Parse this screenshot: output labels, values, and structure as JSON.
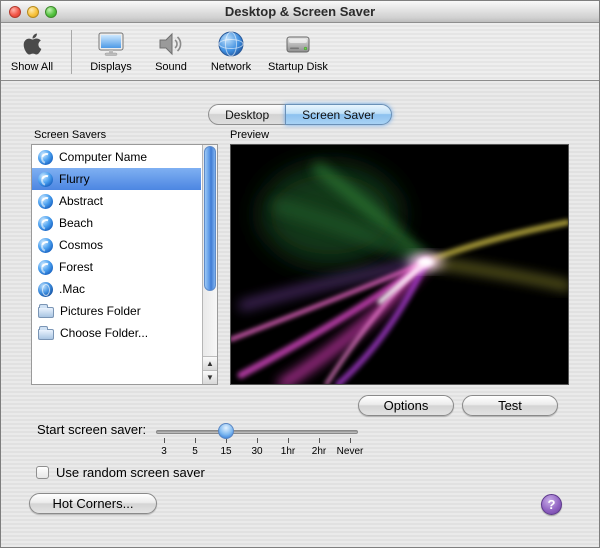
{
  "window": {
    "title": "Desktop & Screen Saver"
  },
  "toolbar": {
    "items": [
      {
        "label": "Show All",
        "icon": "apple-icon"
      },
      {
        "label": "Displays",
        "icon": "display-icon"
      },
      {
        "label": "Sound",
        "icon": "speaker-icon"
      },
      {
        "label": "Network",
        "icon": "globe-icon"
      },
      {
        "label": "Startup Disk",
        "icon": "disk-icon"
      }
    ]
  },
  "tabs": {
    "desktop": "Desktop",
    "screen_saver": "Screen Saver",
    "selected": "Screen Saver"
  },
  "list": {
    "label": "Screen Savers",
    "selected": "Flurry",
    "items": [
      {
        "name": "Computer Name",
        "icon": "swirl-icon",
        "selected": false
      },
      {
        "name": "Flurry",
        "icon": "swirl-icon",
        "selected": true
      },
      {
        "name": "Abstract",
        "icon": "swirl-icon",
        "selected": false
      },
      {
        "name": "Beach",
        "icon": "swirl-icon",
        "selected": false
      },
      {
        "name": "Cosmos",
        "icon": "swirl-icon",
        "selected": false
      },
      {
        "name": "Forest",
        "icon": "swirl-icon",
        "selected": false
      },
      {
        "name": ".Mac",
        "icon": "globe-icon",
        "selected": false
      },
      {
        "name": "Pictures Folder",
        "icon": "folder-icon",
        "selected": false
      },
      {
        "name": "Choose Folder...",
        "icon": "folder-icon",
        "selected": false
      }
    ]
  },
  "preview": {
    "label": "Preview"
  },
  "actions": {
    "options": "Options",
    "test": "Test",
    "hot_corners": "Hot Corners...",
    "help": "?"
  },
  "slider": {
    "label": "Start screen saver:",
    "ticks": [
      "3",
      "5",
      "15",
      "30",
      "1hr",
      "2hr",
      "Never"
    ],
    "value": "15"
  },
  "random": {
    "label": "Use random screen saver",
    "checked": false
  },
  "colors": {
    "selection_blue": "#4c86e2",
    "aqua_tab_blue": "#8cc1ef",
    "help_purple": "#8d5fc0"
  }
}
